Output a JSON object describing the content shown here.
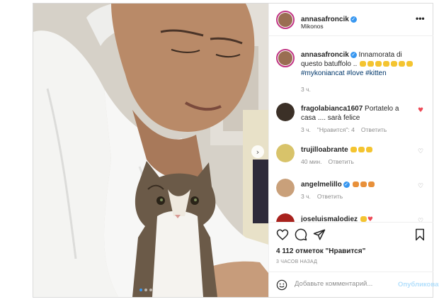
{
  "post": {
    "username": "annasafroncik",
    "location": "Mikonos",
    "caption_user": "annasafroncik",
    "caption_text": "Innamorata di questo batuffolo ..",
    "caption_hashtags": "#mykoniancat #love #kitten",
    "caption_time": "3 ч.",
    "likes": "4 112 отметок \"Нравится\"",
    "time_ago": "3 ЧАСОВ НАЗАД"
  },
  "comments": [
    {
      "user": "fragolabianca1607",
      "text": "Portatelo a casa .... sarà felice",
      "time": "3 ч.",
      "likes_label": "\"Нравится\": 4",
      "reply": "Ответить",
      "liked": true,
      "avatar_color": "#3b3027"
    },
    {
      "user": "trujilloabrante",
      "text": "",
      "time": "40 мин.",
      "reply": "Ответить",
      "liked": false,
      "avatar_color": "#d8c36a"
    },
    {
      "user": "angelmelillo",
      "text": "",
      "time": "3 ч.",
      "reply": "Ответить",
      "liked": false,
      "avatar_color": "#c9a07a"
    },
    {
      "user": "joseluismalodiez",
      "text": "",
      "liked": false,
      "avatar_color": "#a8221d"
    }
  ],
  "comment_bar": {
    "placeholder": "Добавьте комментарий...",
    "post_label": "Опубликовать"
  },
  "colors": {
    "accent_blue": "#3897f0",
    "heart_red": "#ed4956",
    "post_disabled": "#b2dffc"
  },
  "icons": [
    "more-icon",
    "heart-icon",
    "comment-icon",
    "share-icon",
    "bookmark-icon",
    "emoji-icon",
    "next-arrow-icon",
    "verified-icon"
  ]
}
